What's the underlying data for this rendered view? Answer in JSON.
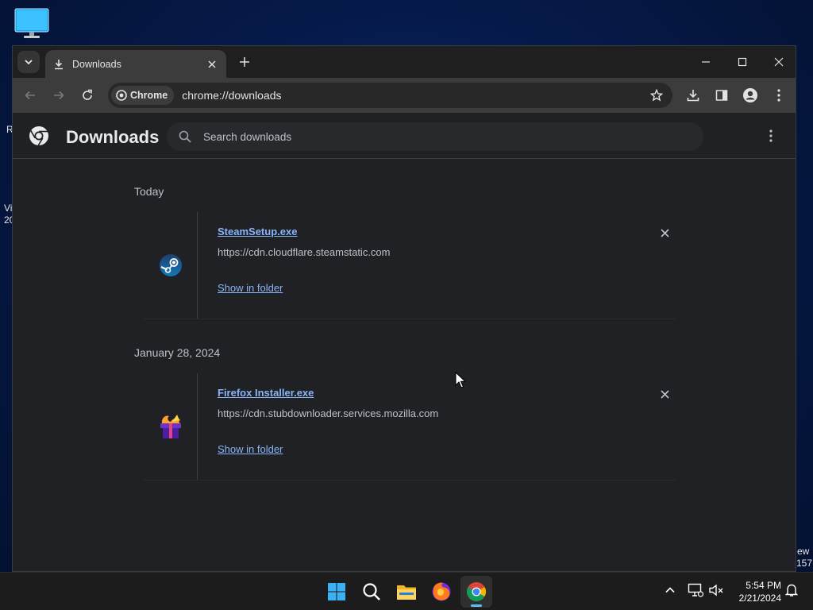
{
  "desktop": {
    "left_fragments": [
      "R",
      "Vi",
      "20"
    ],
    "right_fragments": [
      "ew",
      "157"
    ]
  },
  "browser": {
    "tab": {
      "title": "Downloads"
    },
    "address": {
      "chip_label": "Chrome",
      "url": "chrome://downloads"
    }
  },
  "downloads_page": {
    "title": "Downloads",
    "search_placeholder": "Search downloads",
    "groups": [
      {
        "date": "Today",
        "items": [
          {
            "file_name": "SteamSetup.exe",
            "source_url": "https://cdn.cloudflare.steamstatic.com",
            "action_label": "Show in folder",
            "icon": "steam-app-icon"
          }
        ]
      },
      {
        "date": "January 28, 2024",
        "items": [
          {
            "file_name": "Firefox Installer.exe",
            "source_url": "https://cdn.stubdownloader.services.mozilla.com",
            "action_label": "Show in folder",
            "icon": "firefox-installer-icon"
          }
        ]
      }
    ]
  },
  "taskbar": {
    "apps": [
      "windows-start-icon",
      "search-icon",
      "file-explorer-icon",
      "firefox-icon",
      "chrome-icon"
    ],
    "active_app": "chrome-icon",
    "clock": {
      "time": "5:54 PM",
      "date": "2/21/2024"
    }
  },
  "colors": {
    "link": "#8ab4f8",
    "page_bg": "#202124",
    "toolbar_bg": "#3c3c3c",
    "taskbar_accent": "#5bc0f8"
  }
}
